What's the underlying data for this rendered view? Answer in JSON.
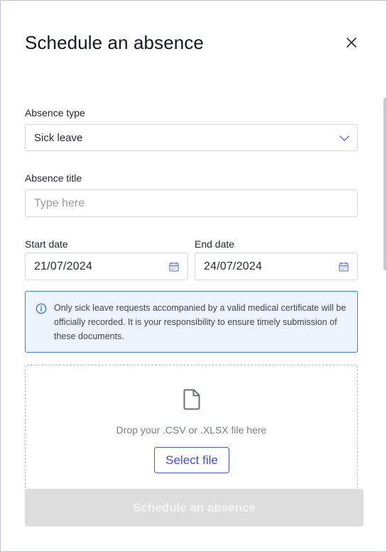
{
  "dialog": {
    "title": "Schedule an absence",
    "close_icon": "close-icon"
  },
  "form": {
    "absence_type": {
      "label": "Absence type",
      "value": "Sick leave",
      "icon": "chevron-down-icon"
    },
    "absence_title": {
      "label": "Absence title",
      "placeholder": "Type here",
      "value": ""
    },
    "start_date": {
      "label": "Start date",
      "value": "21/07/2024",
      "icon": "calendar-icon"
    },
    "end_date": {
      "label": "End date",
      "value": "24/07/2024",
      "icon": "calendar-icon"
    },
    "notice": {
      "icon": "info-icon",
      "text": "Only sick leave requests accompanied by a valid medical certificate will be officially recorded. It is your responsibility to ensure timely submission of these documents."
    },
    "upload": {
      "icon": "file-icon",
      "drop_text": "Drop your .CSV or .XLSX file here",
      "button_label": "Select file"
    },
    "submit_label": "Schedule an absence"
  },
  "colors": {
    "accent": "#3e4fd0",
    "notice_border": "#3c7fd6",
    "notice_bg": "#eef4fd",
    "disabled_button": "#dddddd"
  }
}
